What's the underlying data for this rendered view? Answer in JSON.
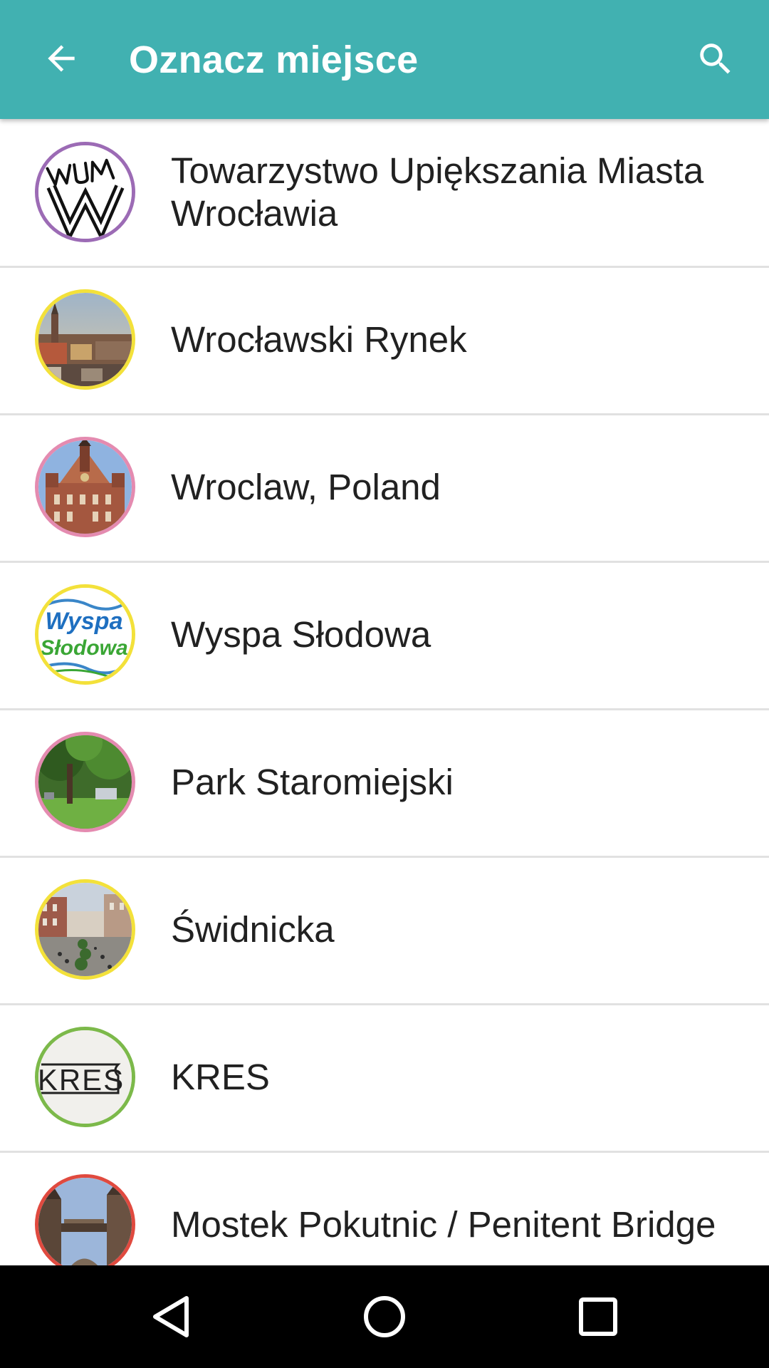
{
  "appbar": {
    "title": "Oznacz miejsce",
    "back_icon": "arrow-back-icon",
    "search_icon": "search-icon",
    "background_color": "#41b1b1"
  },
  "places": [
    {
      "name": "Towarzystwo Upiększania Miasta Wrocławia",
      "icon": "tumw-logo",
      "ring_color": "#9c6bb5"
    },
    {
      "name": "Wrocławski Rynek",
      "icon": "city-panorama-photo",
      "ring_color": "#f3e13a"
    },
    {
      "name": "Wroclaw, Poland",
      "icon": "town-hall-photo",
      "ring_color": "#e48bb0"
    },
    {
      "name": "Wyspa Słodowa",
      "icon": "wyspa-slodowa-logo",
      "ring_color": "#f3e13a",
      "logo_text": [
        "Wyspa",
        "Słodowa"
      ]
    },
    {
      "name": "Park Staromiejski",
      "icon": "park-photo",
      "ring_color": "#e48bb0"
    },
    {
      "name": "Świdnicka",
      "icon": "street-photo",
      "ring_color": "#f3e13a"
    },
    {
      "name": "KRES",
      "icon": "kres-logo",
      "ring_color": "#7cb94a",
      "logo_text": "KRES"
    },
    {
      "name": "Mostek Pokutnic / Penitent Bridge",
      "icon": "bridge-photo",
      "ring_color": "#e04a3f"
    }
  ],
  "navbar": {
    "back_icon": "nav-back-icon",
    "home_icon": "nav-home-icon",
    "recents_icon": "nav-recents-icon"
  }
}
